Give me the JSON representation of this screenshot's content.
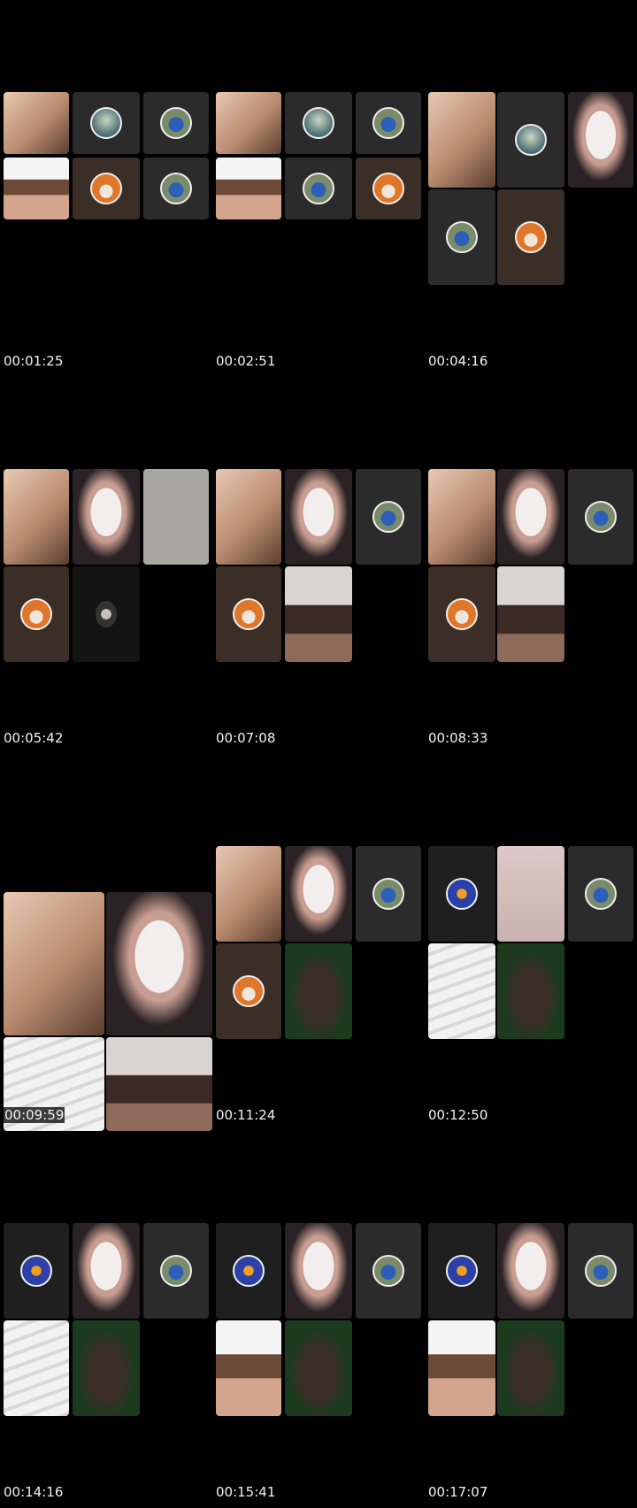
{
  "timestamps": [
    "00:01:25",
    "00:02:51",
    "00:04:16",
    "00:05:42",
    "00:07:08",
    "00:08:33",
    "00:09:59",
    "00:11:24",
    "00:12:50",
    "00:14:16",
    "00:15:41",
    "00:17:07"
  ]
}
